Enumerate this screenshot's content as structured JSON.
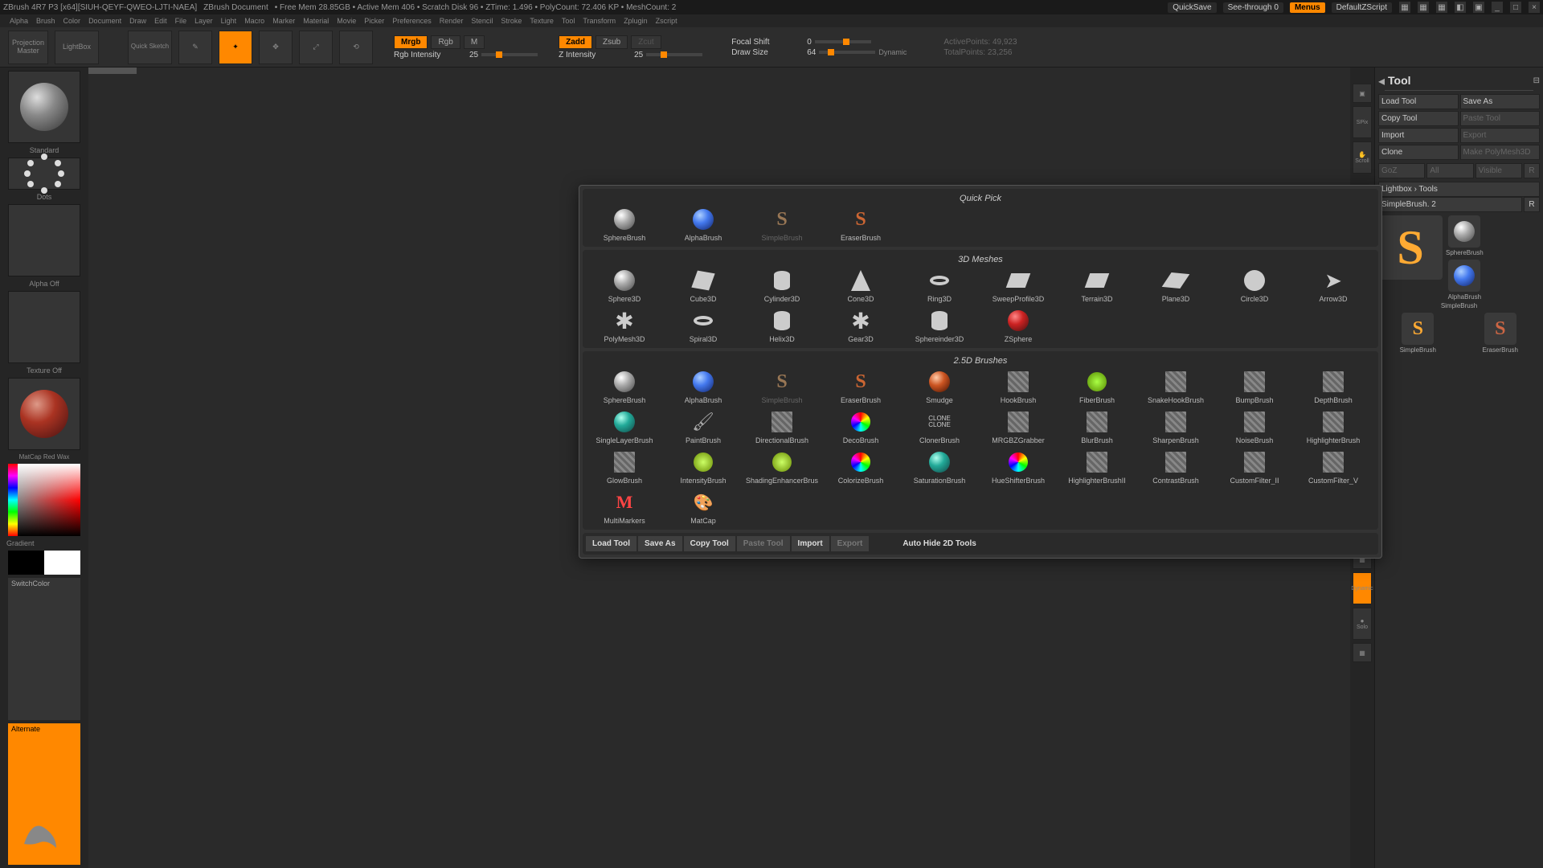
{
  "title_bar": {
    "app": "ZBrush 4R7 P3 [x64][SIUH-QEYF-QWEO-LJTI-NAEA]",
    "doc": "ZBrush Document",
    "mem": "• Free Mem 28.85GB • Active Mem 406 • Scratch Disk 96 • ZTime: 1.496 • PolyCount: 72.406 KP • MeshCount: 2",
    "quicksave": "QuickSave",
    "seethrough": "See-through  0",
    "menus": "Menus",
    "script": "DefaultZScript"
  },
  "menus": [
    "Alpha",
    "Brush",
    "Color",
    "Document",
    "Draw",
    "Edit",
    "File",
    "Layer",
    "Light",
    "Macro",
    "Marker",
    "Material",
    "Movie",
    "Picker",
    "Preferences",
    "Render",
    "Stencil",
    "Stroke",
    "Texture",
    "Tool",
    "Transform",
    "Zplugin",
    "Zscript"
  ],
  "shelf": {
    "projection": "Projection\nMaster",
    "lightbox": "LightBox",
    "quicksketch": "Quick\nSketch",
    "mrgb": "Mrgb",
    "rgb": "Rgb",
    "m": "M",
    "rgb_label": "Rgb Intensity",
    "rgb_val": "25",
    "zadd": "Zadd",
    "zsub": "Zsub",
    "zcut": "Zcut",
    "z_label": "Z Intensity",
    "z_val": "25",
    "focal_label": "Focal Shift",
    "focal_val": "0",
    "draw_label": "Draw Size",
    "draw_val": "64",
    "dynamic": "Dynamic",
    "active_pts": "ActivePoints: 49,923",
    "total_pts": "TotalPoints: 23,256"
  },
  "left": {
    "brush_name": "Standard",
    "stroke": "Dots",
    "alpha": "Alpha Off",
    "texture": "Texture Off",
    "material": "MatCap Red Wax",
    "gradient": "Gradient",
    "switchcolor": "SwitchColor",
    "alternate": "Alternate"
  },
  "right_tools": [
    "BPR",
    "SPix",
    "Scroll",
    "",
    "",
    "",
    "",
    "",
    "",
    "",
    "Move",
    "Scale",
    "Rotate",
    "",
    "",
    "",
    "Dynamic",
    "Solo",
    ""
  ],
  "panel": {
    "title": "Tool",
    "load": "Load Tool",
    "save": "Save As",
    "copy": "Copy Tool",
    "paste": "Paste Tool",
    "import": "Import",
    "export": "Export",
    "clone": "Clone",
    "makepm": "Make PolyMesh3D",
    "goz": "GoZ",
    "all": "All",
    "visible": "Visible",
    "r": "R",
    "lightbox": "Lightbox › Tools",
    "current": "SimpleBrush. 2",
    "rbtn": "R",
    "thumbs": [
      "SimpleBrush",
      "SphereBrush",
      "SimpleBrush",
      "AlphaBrush",
      "SimpleBrush",
      "EraserBrush"
    ]
  },
  "popup": {
    "quickpick": "Quick Pick",
    "meshes": "3D Meshes",
    "brushes": "2.5D Brushes",
    "qp_items": [
      "SphereBrush",
      "AlphaBrush",
      "SimpleBrush",
      "EraserBrush"
    ],
    "mesh_items": [
      "Sphere3D",
      "Cube3D",
      "Cylinder3D",
      "Cone3D",
      "Ring3D",
      "SweepProfile3D",
      "Terrain3D",
      "Plane3D",
      "Circle3D",
      "Arrow3D",
      "PolyMesh3D",
      "Spiral3D",
      "Helix3D",
      "Gear3D",
      "Sphereinder3D",
      "ZSphere"
    ],
    "brush_items": [
      "SphereBrush",
      "AlphaBrush",
      "SimpleBrush",
      "EraserBrush",
      "Smudge",
      "HookBrush",
      "FiberBrush",
      "SnakeHookBrush",
      "BumpBrush",
      "DepthBrush",
      "SingleLayerBrush",
      "PaintBrush",
      "DirectionalBrush",
      "DecoBrush",
      "ClonerBrush",
      "MRGBZGrabber",
      "BlurBrush",
      "SharpenBrush",
      "NoiseBrush",
      "HighlighterBrush",
      "GlowBrush",
      "IntensityBrush",
      "ShadingEnhancerBrus",
      "ColorizeBrush",
      "SaturationBrush",
      "HueShifterBrush",
      "HighlighterBrushII",
      "ContrastBrush",
      "CustomFilter_II",
      "CustomFilter_V",
      "MultiMarkers",
      "MatCap"
    ],
    "load": "Load Tool",
    "save": "Save As",
    "copy": "Copy Tool",
    "paste": "Paste Tool",
    "import": "Import",
    "export": "Export",
    "autohide": "Auto Hide 2D Tools"
  }
}
